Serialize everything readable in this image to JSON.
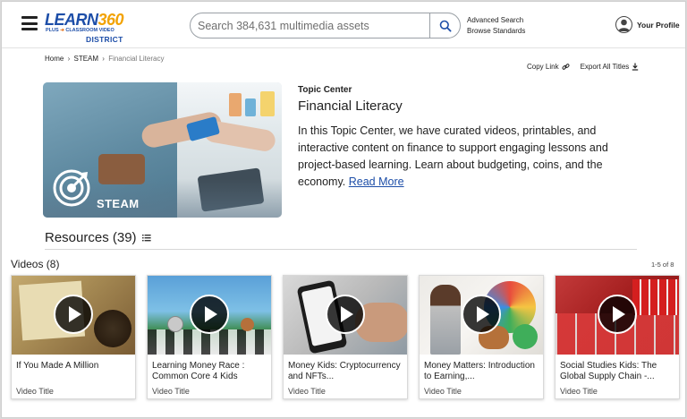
{
  "header": {
    "logo": {
      "brand_text": "LEARN",
      "brand_num": "360",
      "sub_text_a": "PLUS",
      "sub_text_b": "CLASSROOM VIDEO",
      "district": "DISTRICT"
    },
    "search": {
      "placeholder": "Search 384,631 multimedia assets",
      "value": ""
    },
    "advanced_search": "Advanced Search",
    "browse_standards": "Browse Standards",
    "profile_label": "Your Profile"
  },
  "breadcrumb": {
    "items": [
      "Home",
      "STEAM"
    ],
    "current": "Financial Literacy",
    "separator": "›"
  },
  "tools": {
    "copy_link": "Copy Link",
    "export_all": "Export All Titles"
  },
  "hero": {
    "badge_label": "STEAM",
    "section_label": "Topic Center",
    "title": "Financial Literacy",
    "description": "In this Topic Center, we have curated videos, printables, and interactive content on finance to support engaging lessons and project-based learning. Learn about budgeting, coins, and the economy.",
    "read_more": "Read More"
  },
  "resources": {
    "label": "Resources (39)"
  },
  "videos": {
    "heading": "Videos (8)",
    "pager": "1-5 of 8",
    "items": [
      {
        "title": "If You Made A Million",
        "type": "Video Title"
      },
      {
        "title": "Learning Money Race : Common Core 4 Kids",
        "type": "Video Title"
      },
      {
        "title": "Money Kids: Cryptocurrency and NFTs...",
        "type": "Video Title"
      },
      {
        "title": "Money Matters: Introduction to Earning,...",
        "type": "Video Title"
      },
      {
        "title": "Social Studies Kids: The Global Supply Chain -...",
        "type": "Video Title"
      }
    ]
  },
  "colors": {
    "brand_blue": "#1d4ea8",
    "brand_orange": "#e46b10",
    "link_blue": "#1d4ea8"
  },
  "icons": [
    "menu-icon",
    "search-icon",
    "user-icon",
    "link-icon",
    "download-icon",
    "target-icon",
    "list-icon",
    "play-icon"
  ]
}
